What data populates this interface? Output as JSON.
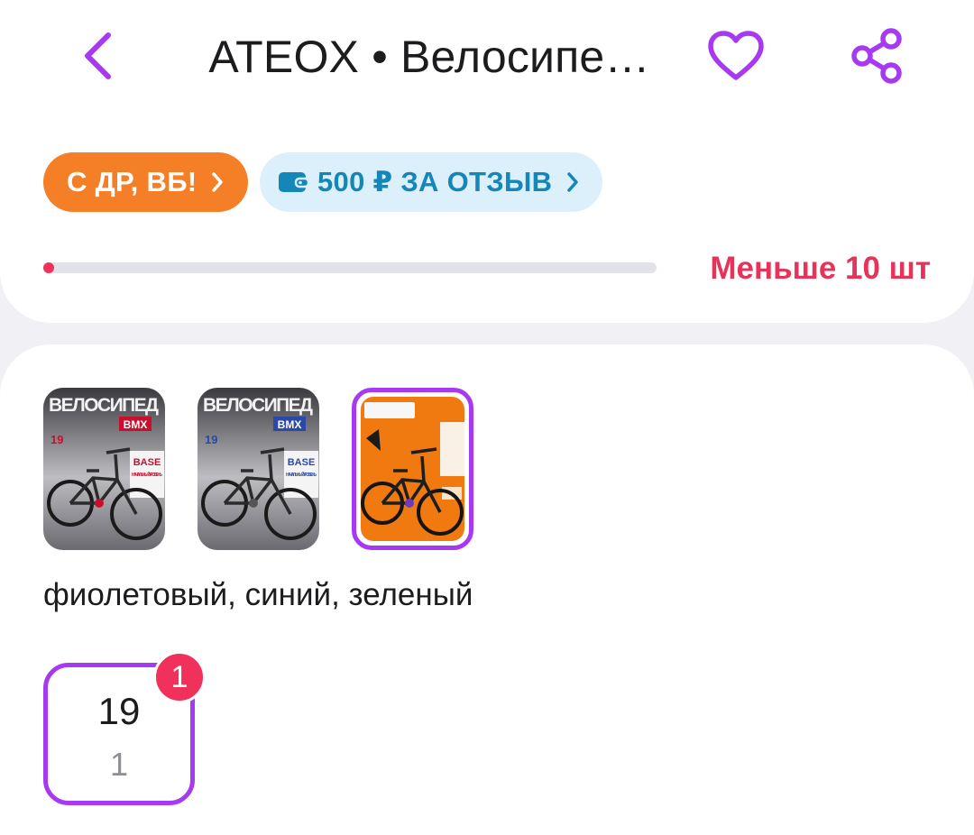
{
  "header": {
    "title": "ATEOX • Велосипе…",
    "back_icon": "chevron-left-icon",
    "favorite_icon": "heart-icon",
    "share_icon": "share-icon",
    "accent_color": "#a73af0"
  },
  "badges": {
    "promo_label": "С ДР, ВБ!",
    "review_label": "500 ₽ ЗА ОТЗЫВ",
    "promo_color": "#f57f27",
    "review_color": "#1486b8"
  },
  "stock": {
    "label": "Меньше 10 шт",
    "level": 0.01,
    "color": "#e6335a"
  },
  "variants": {
    "thumbnails": [
      {
        "headline": "ВЕЛОСИПЕД",
        "tag": "BMX",
        "model": "BASE",
        "caption": "НАЧАЛЬНЫЙ УРОВЕНЬ",
        "accent": "#c8102e",
        "selected": false
      },
      {
        "headline": "ВЕЛОСИПЕД",
        "tag": "BMX",
        "model": "BASE",
        "caption": "НАЧАЛЬНЫЙ УРОВЕНЬ",
        "accent": "#2a49a8",
        "selected": false
      },
      {
        "headline": "",
        "tag": "",
        "model": "",
        "caption": "",
        "accent": "#f07a10",
        "selected": true
      }
    ],
    "color_text": "фиолетовый, синий, зеленый"
  },
  "size": {
    "value": "19",
    "sub_value": "1",
    "count_badge": "1"
  }
}
